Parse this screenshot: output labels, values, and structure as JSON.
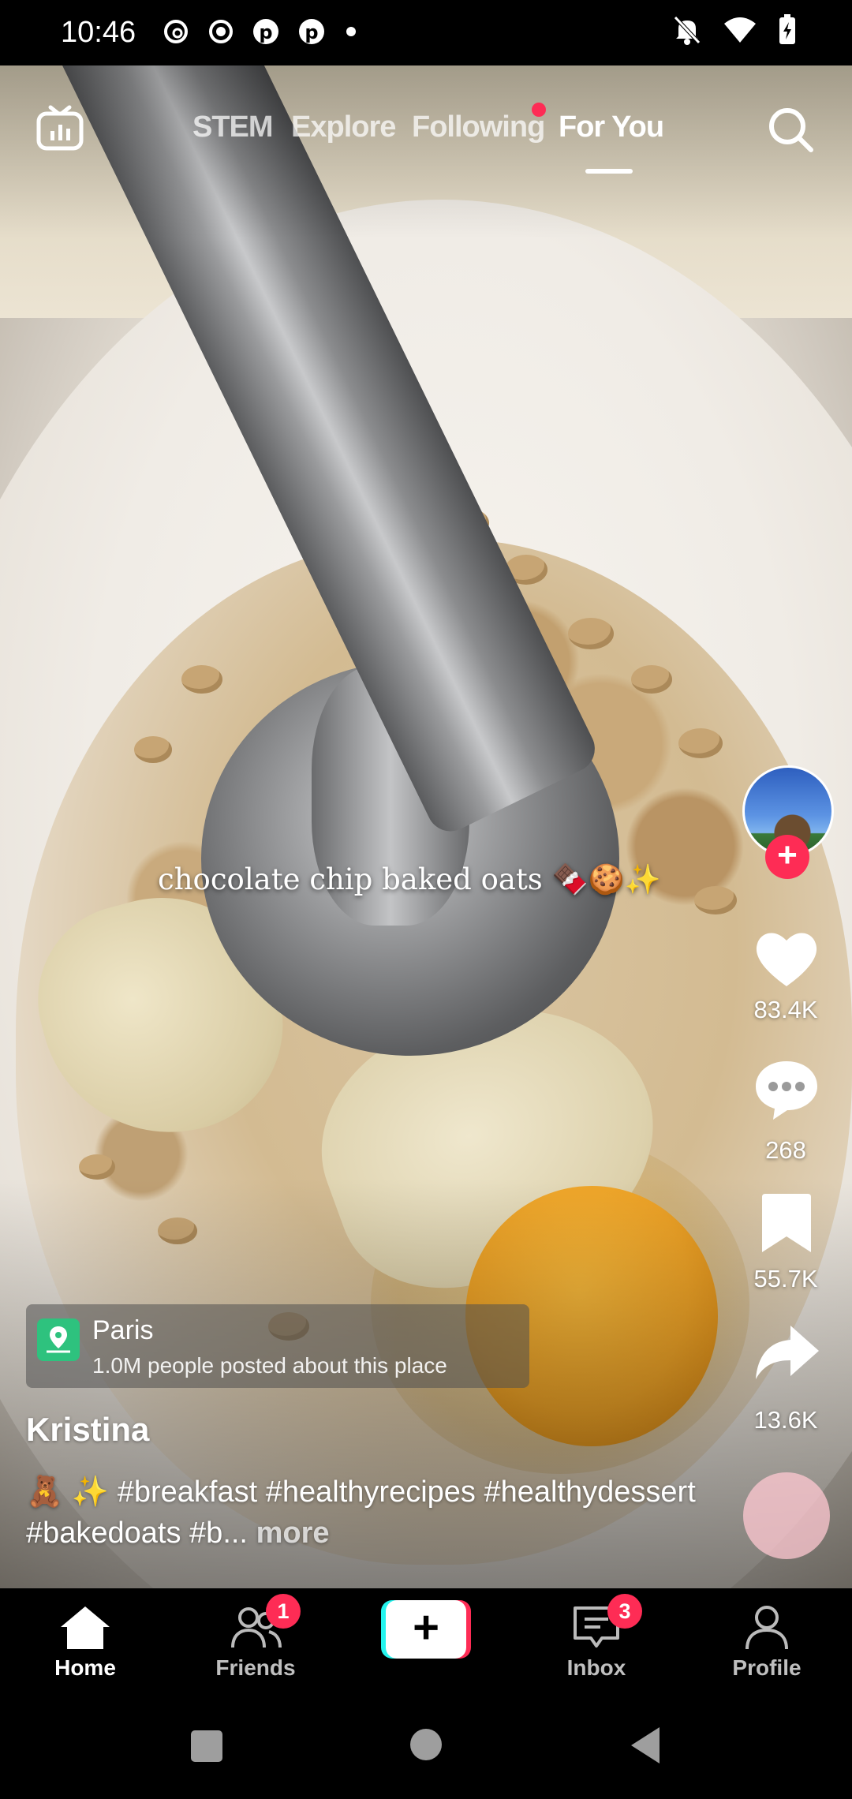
{
  "status_bar": {
    "time": "10:46",
    "left_icons": [
      "threads-icon",
      "record-icon",
      "pinterest-icon",
      "pinterest-icon",
      "dot-icon"
    ],
    "right_icons": [
      "mute-icon",
      "wifi-icon",
      "battery-charging-icon"
    ]
  },
  "top_nav": {
    "live_icon": "tv-icon",
    "tabs": [
      {
        "label": "STEM"
      },
      {
        "label": "Explore"
      },
      {
        "label": "Following"
      },
      {
        "label": "For You"
      }
    ],
    "active_tab": "For You",
    "search_icon": "search-icon"
  },
  "video": {
    "overlay_caption": "chocolate chip baked oats 🍫🍪✨"
  },
  "actions": {
    "likes": "83.4K",
    "comments": "268",
    "saves": "55.7K",
    "shares": "13.6K"
  },
  "location": {
    "name": "Paris",
    "subtitle": "1.0M people posted about this place"
  },
  "post": {
    "username": "Kristina",
    "description": "🧸 ✨ #breakfast #healthyrecipes #healthydessert #bakedoats #b...",
    "more_label": "more"
  },
  "bottom_nav": {
    "items": [
      {
        "label": "Home"
      },
      {
        "label": "Friends",
        "badge": "1"
      },
      {
        "label": "Inbox",
        "badge": "3"
      },
      {
        "label": "Profile"
      }
    ],
    "create_label": "+"
  },
  "colors": {
    "accent": "#fe2c55",
    "cyan": "#25f4ee",
    "location_icon": "#2ec27e"
  }
}
